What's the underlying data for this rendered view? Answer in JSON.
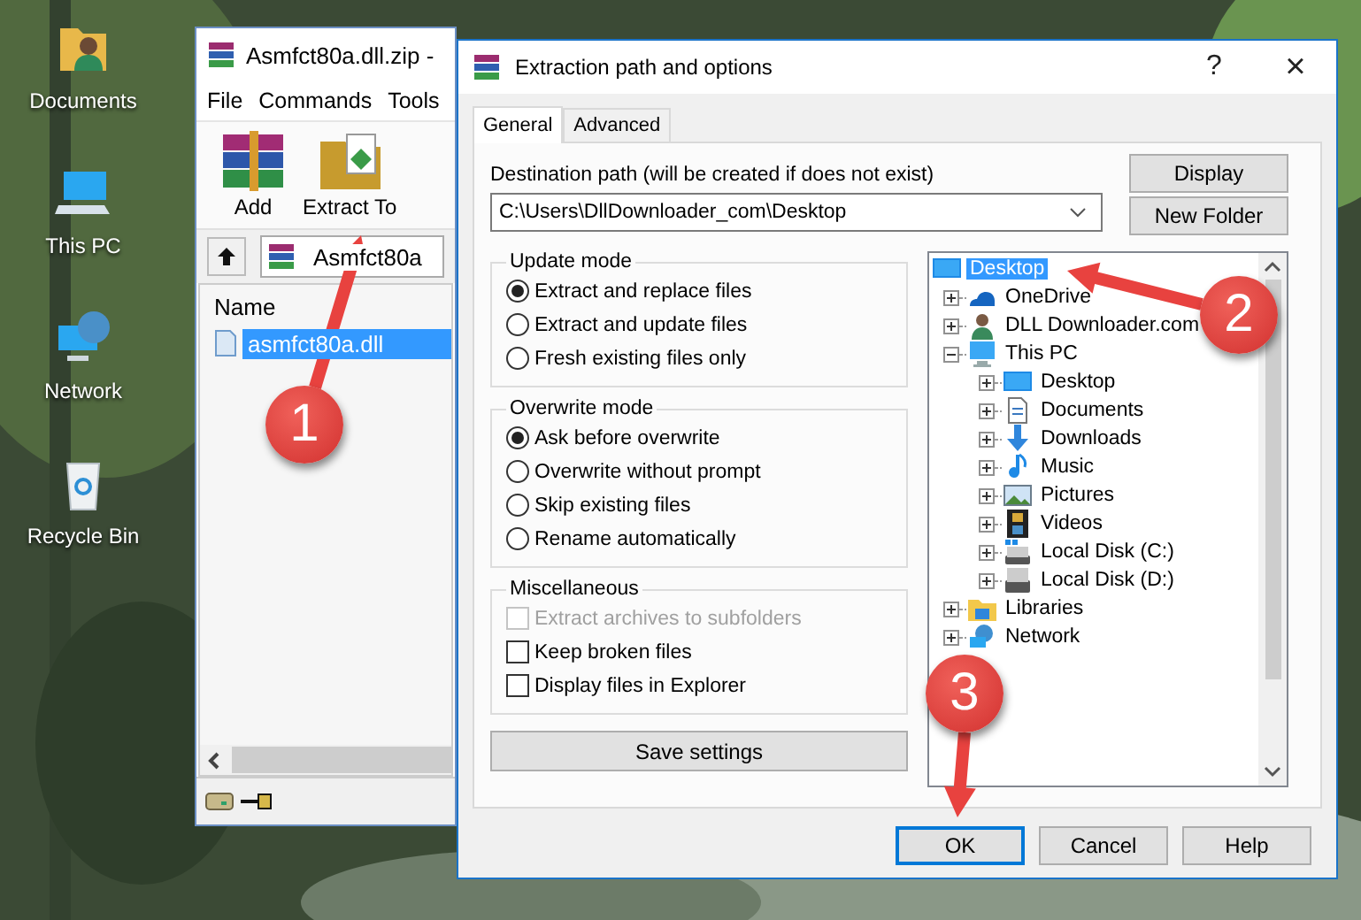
{
  "desktop_icons": [
    {
      "label": "Documents",
      "kind": "documents"
    },
    {
      "label": "This PC",
      "kind": "computer"
    },
    {
      "label": "Network",
      "kind": "network"
    },
    {
      "label": "Recycle Bin",
      "kind": "recycle"
    }
  ],
  "archive_window": {
    "title": "Asmfct80a.dll.zip -",
    "menu": [
      "File",
      "Commands",
      "Tools"
    ],
    "toolbar": [
      {
        "label": "Add",
        "kind": "add"
      },
      {
        "label": "Extract To",
        "kind": "extract"
      }
    ],
    "address": "Asmfct80a",
    "columns": [
      "Name"
    ],
    "files": [
      {
        "name": "asmfct80a.dll",
        "selected": true
      }
    ]
  },
  "dialog": {
    "title": "Extraction path and options",
    "help": "?",
    "close": "×",
    "tabs": [
      {
        "label": "General",
        "selected": true
      },
      {
        "label": "Advanced",
        "selected": false
      }
    ],
    "destination_label": "Destination path (will be created if does not exist)",
    "destination_value": "C:\\Users\\DllDownloader_com\\Desktop",
    "side_buttons": [
      "Display",
      "New Folder"
    ],
    "groups": [
      {
        "title": "Update mode",
        "options": [
          {
            "kind": "radio",
            "label": "Extract and replace files",
            "checked": true,
            "disabled": false
          },
          {
            "kind": "radio",
            "label": "Extract and update files",
            "checked": false,
            "disabled": false
          },
          {
            "kind": "radio",
            "label": "Fresh existing files only",
            "checked": false,
            "disabled": false
          }
        ]
      },
      {
        "title": "Overwrite mode",
        "options": [
          {
            "kind": "radio",
            "label": "Ask before overwrite",
            "checked": true,
            "disabled": false
          },
          {
            "kind": "radio",
            "label": "Overwrite without prompt",
            "checked": false,
            "disabled": false
          },
          {
            "kind": "radio",
            "label": "Skip existing files",
            "checked": false,
            "disabled": false
          },
          {
            "kind": "radio",
            "label": "Rename automatically",
            "checked": false,
            "disabled": false
          }
        ]
      },
      {
        "title": "Miscellaneous",
        "options": [
          {
            "kind": "checkbox",
            "label": "Extract archives to subfolders",
            "checked": false,
            "disabled": true
          },
          {
            "kind": "checkbox",
            "label": "Keep broken files",
            "checked": false,
            "disabled": false
          },
          {
            "kind": "checkbox",
            "label": "Display files in Explorer",
            "checked": false,
            "disabled": false
          }
        ]
      }
    ],
    "save_button": "Save settings",
    "tree": [
      {
        "label": "Desktop",
        "kind": "desktop",
        "selected": true,
        "children": [
          {
            "label": "OneDrive",
            "kind": "cloud",
            "selected": false,
            "expanded": false
          },
          {
            "label": "DLL Downloader.com",
            "kind": "user",
            "selected": false,
            "expanded": false
          },
          {
            "label": "This PC",
            "kind": "computer",
            "selected": false,
            "expanded": true,
            "children": [
              {
                "label": "Desktop",
                "kind": "desktop",
                "selected": false,
                "expanded": false
              },
              {
                "label": "Documents",
                "kind": "document",
                "selected": false,
                "expanded": false
              },
              {
                "label": "Downloads",
                "kind": "download",
                "selected": false,
                "expanded": false
              },
              {
                "label": "Music",
                "kind": "music",
                "selected": false,
                "expanded": false
              },
              {
                "label": "Pictures",
                "kind": "picture",
                "selected": false,
                "expanded": false
              },
              {
                "label": "Videos",
                "kind": "video",
                "selected": false,
                "expanded": false
              },
              {
                "label": "Local Disk (C:)",
                "kind": "system-disk",
                "selected": false,
                "expanded": false
              },
              {
                "label": "Local Disk (D:)",
                "kind": "disk",
                "selected": false,
                "expanded": false
              }
            ]
          },
          {
            "label": "Libraries",
            "kind": "library",
            "selected": false,
            "expanded": false
          },
          {
            "label": "Network",
            "kind": "network",
            "selected": false,
            "expanded": false
          }
        ]
      }
    ],
    "buttons": [
      {
        "label": "OK",
        "default": true
      },
      {
        "label": "Cancel",
        "default": false
      },
      {
        "label": "Help",
        "default": false
      }
    ]
  },
  "annotations": [
    {
      "label": "1"
    },
    {
      "label": "2"
    },
    {
      "label": "3"
    }
  ]
}
